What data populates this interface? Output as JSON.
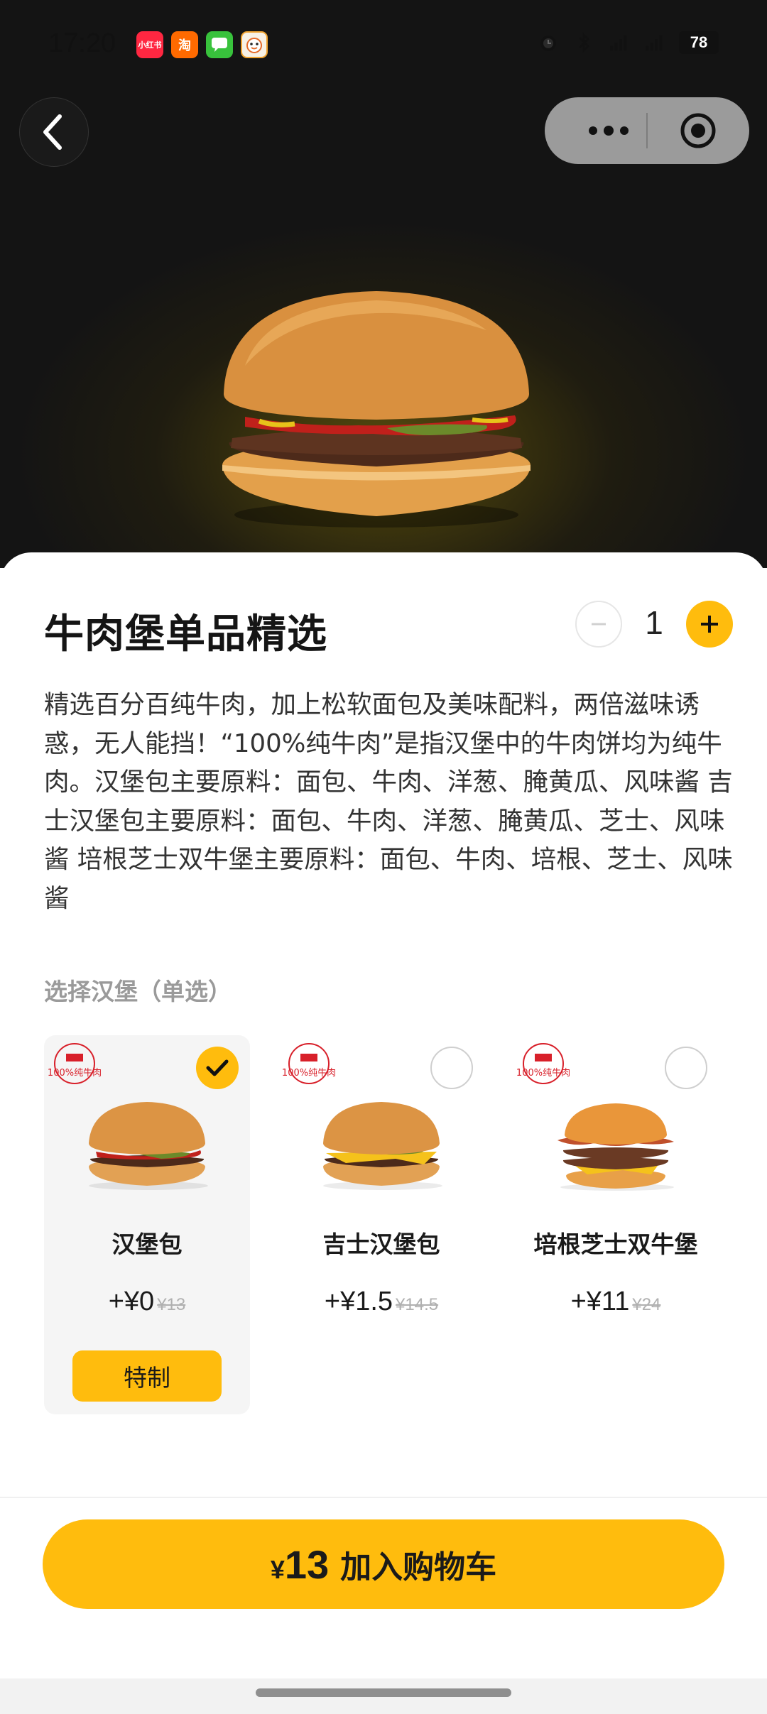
{
  "status_bar": {
    "time": "17:20",
    "apps": [
      "小红书",
      "淘",
      "",
      ""
    ],
    "battery": "78"
  },
  "nav": {
    "back_icon": "chevron-left-icon",
    "more_icon": "more-dots-icon",
    "close_icon": "target-circle-icon"
  },
  "product": {
    "title": "牛肉堡单品精选",
    "quantity": "1",
    "description": "精选百分百纯牛肉，加上松软面包及美味配料，两倍滋味诱惑，无人能挡！“100%纯牛肉”是指汉堡中的牛肉饼均为纯牛肉。汉堡包主要原料：面包、牛肉、洋葱、腌黄瓜、风味酱 吉士汉堡包主要原料：面包、牛肉、洋葱、腌黄瓜、芝士、风味酱 培根芝士双牛堡主要原料：面包、牛肉、培根、芝士、风味酱"
  },
  "selection": {
    "label": "选择汉堡（单选）",
    "badge_text": "100%纯牛肉",
    "options": [
      {
        "name": "汉堡包",
        "price": "+¥0",
        "original": "¥13",
        "selected": true,
        "custom_label": "特制"
      },
      {
        "name": "吉士汉堡包",
        "price": "+¥1.5",
        "original": "¥14.5",
        "selected": false
      },
      {
        "name": "培根芝士双牛堡",
        "price": "+¥11",
        "original": "¥24",
        "selected": false
      }
    ]
  },
  "cart": {
    "currency": "¥",
    "amount": "13",
    "label": "加入购物车"
  },
  "colors": {
    "accent": "#ffbc0d",
    "hero_bg": "#141414"
  }
}
